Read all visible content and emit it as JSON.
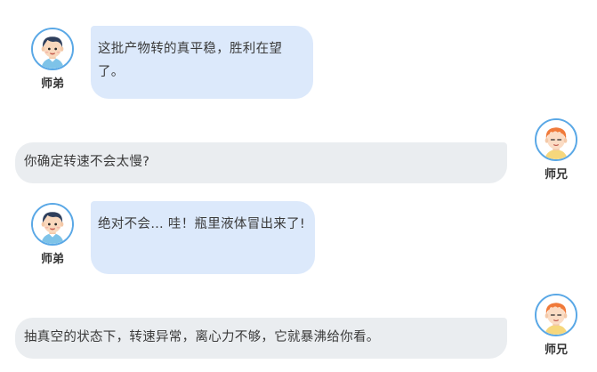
{
  "speakers": {
    "left": {
      "name": "师弟",
      "avatar": "boy-dark-hair-icon"
    },
    "right": {
      "name": "师兄",
      "avatar": "boy-orange-hair-icon"
    }
  },
  "messages": [
    {
      "speaker": "left",
      "text": "这批产物转的真平稳，胜利在望了。"
    },
    {
      "speaker": "right",
      "text": "你确定转速不会太慢?"
    },
    {
      "speaker": "left",
      "text": "绝对不会… 哇！瓶里液体冒出来了!"
    },
    {
      "speaker": "right",
      "text": "抽真空的状态下，转速异常，离心力不够，它就暴沸给你看。"
    }
  ],
  "colors": {
    "left_bubble": "#dce9fb",
    "right_bubble": "#eaedf0",
    "avatar_ring": "#5aa8e6"
  }
}
